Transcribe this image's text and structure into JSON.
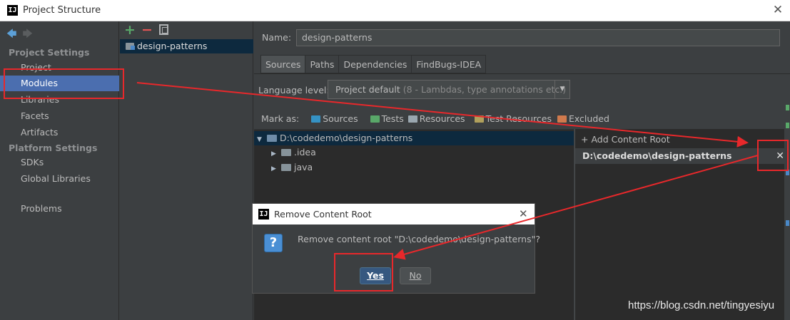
{
  "window": {
    "title": "Project Structure",
    "logo": "IJ",
    "close_glyph": "✕"
  },
  "nav": {
    "back_icon": "◆",
    "forward_icon": "◆",
    "project_settings_heading": "Project Settings",
    "items": [
      "Project",
      "Modules",
      "Libraries",
      "Facets",
      "Artifacts"
    ],
    "platform_settings_heading": "Platform Settings",
    "platform_items": [
      "SDKs",
      "Global Libraries"
    ],
    "problems": "Problems",
    "selected": "Modules"
  },
  "modules": {
    "toolbar": {
      "add": "+",
      "remove": "−"
    },
    "items": [
      "design-patterns"
    ]
  },
  "settings": {
    "name_label": "Name:",
    "name_value": "design-patterns",
    "tabs": [
      "Sources",
      "Paths",
      "Dependencies",
      "FindBugs-IDEA"
    ],
    "active_tab": "Sources",
    "language_level_label": "Language level:",
    "language_level_value": "Project default",
    "language_level_hint": "(8 - Lambdas, type annotations etc.)",
    "mark_as_label": "Mark as:",
    "mark_as": [
      {
        "label": "Sources",
        "color": "#3592c4"
      },
      {
        "label": "Tests",
        "color": "#59a869"
      },
      {
        "label": "Resources",
        "color": "#9aa7b0"
      },
      {
        "label": "Test Resources",
        "color": "#b0a05c"
      },
      {
        "label": "Excluded",
        "color": "#d07a4d"
      }
    ],
    "tree": {
      "root": "D:\\codedemo\\design-patterns",
      "children": [
        ".idea",
        "java"
      ]
    },
    "add_content_root": "Add Content Root",
    "content_root": "D:\\codedemo\\design-patterns",
    "content_root_remove": "✕"
  },
  "dialog": {
    "title": "Remove Content Root",
    "logo": "IJ",
    "close_glyph": "✕",
    "icon": "?",
    "message": "Remove content root \"D:\\codedemo\\design-patterns\"?",
    "yes": "Yes",
    "no": "No"
  },
  "watermark": "https://blog.csdn.net/tingyesiyu",
  "annotation_color": "#e8282b"
}
